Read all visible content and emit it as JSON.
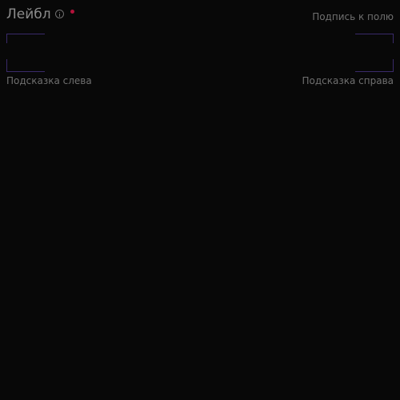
{
  "field": {
    "label": "Лейбл",
    "caption": "Подпись к полю",
    "hint_left": "Подсказка слева",
    "hint_right": "Подсказка справа",
    "info_icon": "info-circle-icon",
    "required_indicator": "required-dot"
  },
  "colors": {
    "background": "#080808",
    "label": "#8b8b8b",
    "secondary_text": "#6f6f6f",
    "required_dot": "#b3123a",
    "input_corner_border": "#3a2a6a"
  }
}
